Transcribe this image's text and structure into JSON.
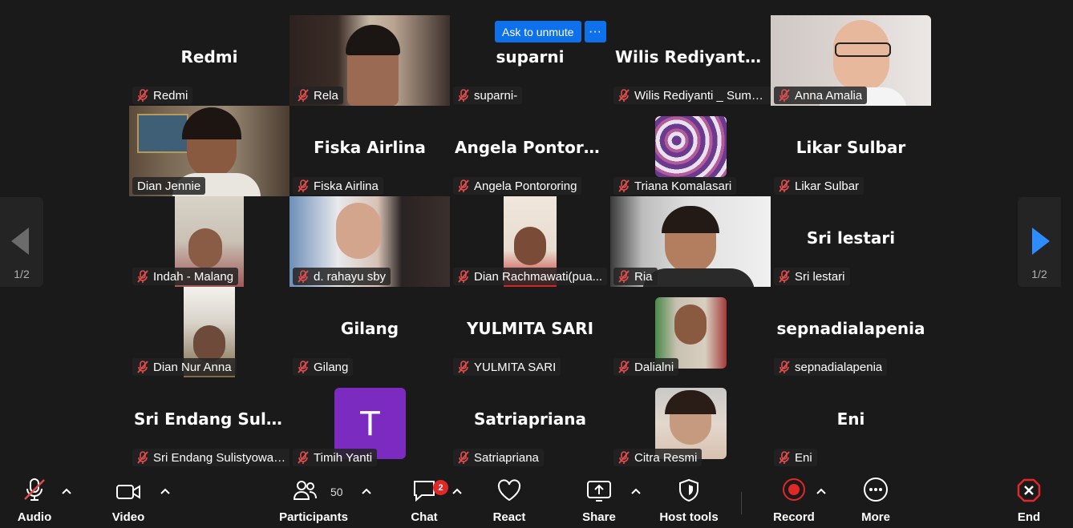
{
  "unmute": {
    "label": "Ask to unmute",
    "more": "···"
  },
  "nav": {
    "left_page": "1/2",
    "right_page": "1/2"
  },
  "tiles": [
    {
      "big": "Redmi",
      "label": "Redmi"
    },
    {
      "big": "",
      "label": "Rela"
    },
    {
      "big": "suparni",
      "label": "suparni-"
    },
    {
      "big": "Wilis  Rediyanti...",
      "label": "Wilis Rediyanti _ Sumb..."
    },
    {
      "big": "",
      "label": "Anna Amalia"
    },
    {
      "big": "",
      "label": "Dian Jennie"
    },
    {
      "big": "Fiska Airlina",
      "label": "Fiska Airlina"
    },
    {
      "big": "Angela  Pontoro...",
      "label": "Angela Pontororing"
    },
    {
      "big": "",
      "label": "Triana Komalasari"
    },
    {
      "big": "Likar Sulbar",
      "label": "Likar Sulbar"
    },
    {
      "big": "",
      "label": "Indah - Malang"
    },
    {
      "big": "",
      "label": "d. rahayu sby"
    },
    {
      "big": "",
      "label": "Dian Rachmawati(pua..."
    },
    {
      "big": "",
      "label": "Ria"
    },
    {
      "big": "Sri lestari",
      "label": "Sri lestari"
    },
    {
      "big": "",
      "label": "Dian Nur Anna"
    },
    {
      "big": "Gilang",
      "label": "Gilang"
    },
    {
      "big": "YULMITA SARI",
      "label": "YULMITA SARI"
    },
    {
      "big": "",
      "label": "Dalialni"
    },
    {
      "big": "sepnadialapenia",
      "label": "sepnadialapenia"
    },
    {
      "big": "Sri  Endang  Sulis...",
      "label": "Sri Endang Sulistyowat..."
    },
    {
      "big": "",
      "label": "Timih Yanti",
      "avatar": "T"
    },
    {
      "big": "Satriapriana",
      "label": "Satriapriana"
    },
    {
      "big": "",
      "label": "Citra Resmi"
    },
    {
      "big": "Eni",
      "label": "Eni"
    }
  ],
  "toolbar": {
    "audio": "Audio",
    "video": "Video",
    "participants": "Participants",
    "participants_count": "50",
    "chat": "Chat",
    "chat_badge": "2",
    "react": "React",
    "share": "Share",
    "host_tools": "Host tools",
    "record": "Record",
    "more": "More",
    "end": "End"
  },
  "colors": {
    "active_border": "#23d959",
    "unmute_blue": "#0e71eb",
    "record_red": "#e02828",
    "avatar_purple": "#7b2bbf"
  }
}
